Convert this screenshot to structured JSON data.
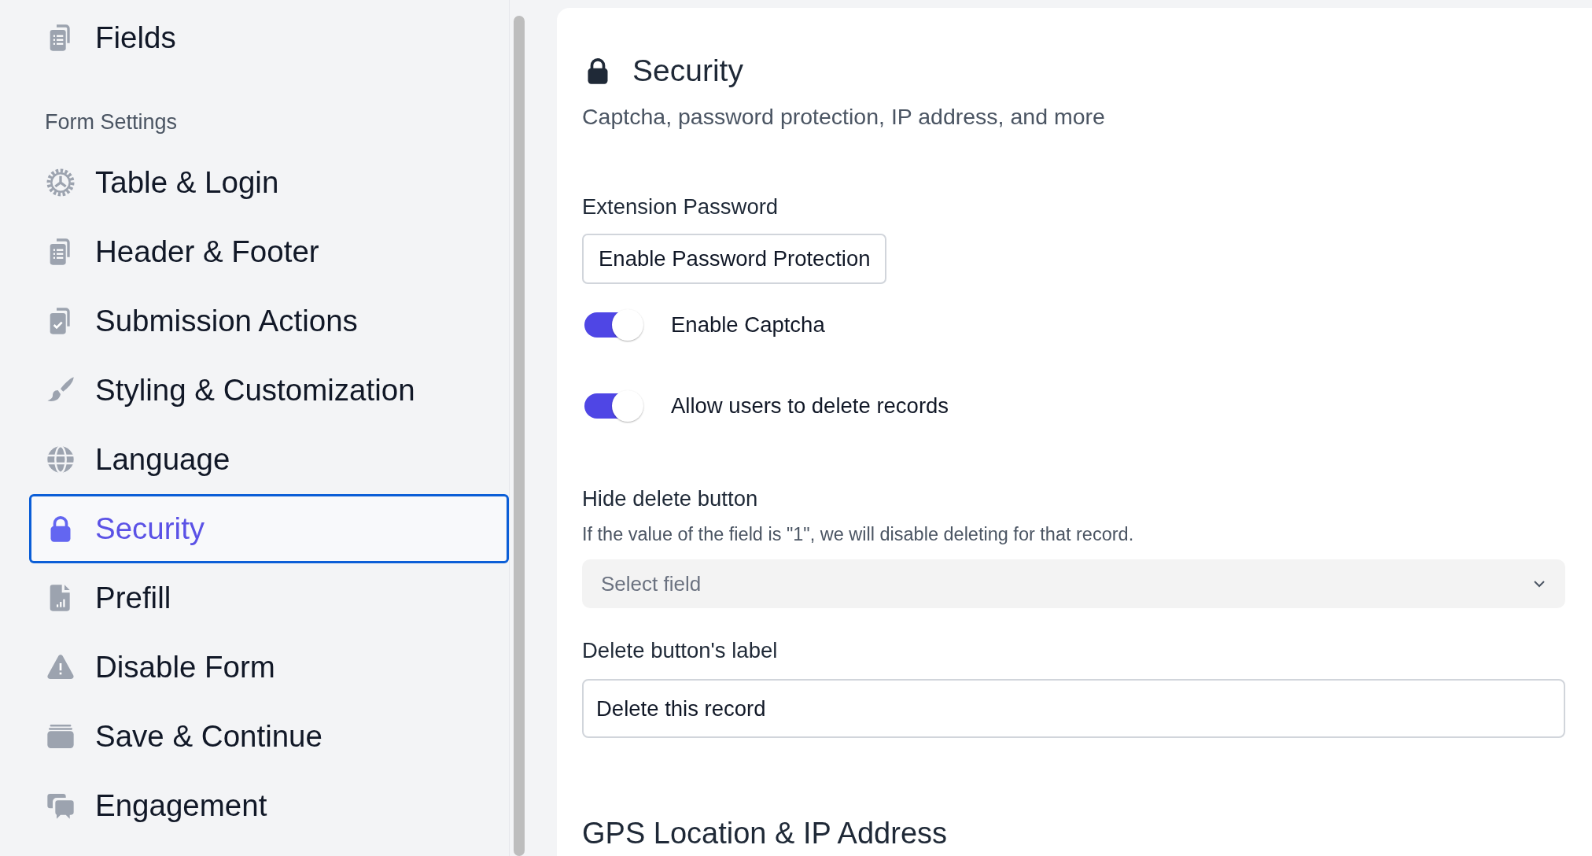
{
  "sidebar": {
    "top_items": [
      {
        "label": "Fields",
        "selected": false
      }
    ],
    "section_title": "Form Settings",
    "items": [
      {
        "label": "Table & Login",
        "selected": false
      },
      {
        "label": "Header & Footer",
        "selected": false
      },
      {
        "label": "Submission Actions",
        "selected": false
      },
      {
        "label": "Styling & Customization",
        "selected": false
      },
      {
        "label": "Language",
        "selected": false
      },
      {
        "label": "Security",
        "selected": true
      },
      {
        "label": "Prefill",
        "selected": false
      },
      {
        "label": "Disable Form",
        "selected": false
      },
      {
        "label": "Save & Continue",
        "selected": false
      },
      {
        "label": "Engagement",
        "selected": false
      }
    ]
  },
  "panel": {
    "title": "Security",
    "subtitle": "Captcha, password protection, IP address, and more",
    "extension_password": {
      "label": "Extension Password",
      "button": "Enable Password Protection"
    },
    "toggles": [
      {
        "label": "Enable Captcha",
        "on": true
      },
      {
        "label": "Allow users to delete records",
        "on": true
      }
    ],
    "hide_delete": {
      "label": "Hide delete button",
      "help": "If the value of the field is \"1\", we will disable deleting for that record.",
      "placeholder": "Select field"
    },
    "delete_label": {
      "label": "Delete button's label",
      "value": "Delete this record"
    },
    "gps_heading": "GPS Location & IP Address"
  }
}
